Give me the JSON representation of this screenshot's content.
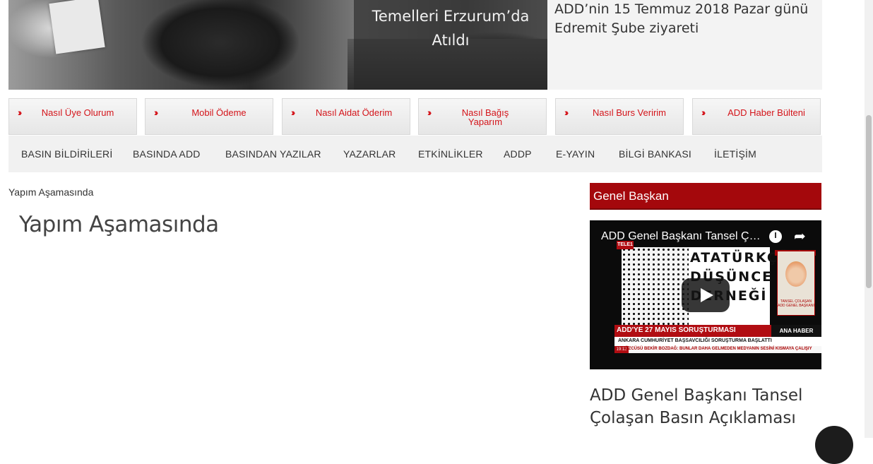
{
  "hero": {
    "caption": "Temelleri Erzurum’da Atıldı",
    "side_news": "ADD’nin 15 Temmuz 2018 Pazar günü Edremit Şube ziyareti"
  },
  "quick_links": [
    {
      "label": "Nasıl Üye Olurum"
    },
    {
      "label": "Mobil Ödeme"
    },
    {
      "label": "Nasıl Aidat Öderim"
    },
    {
      "label": "Nasıl Bağış Yaparım"
    },
    {
      "label": "Nasıl Burs Veririm"
    },
    {
      "label": "ADD Haber Bülteni"
    }
  ],
  "menu": [
    {
      "label": "BASIN BİLDİRİLERİ"
    },
    {
      "label": "BASINDA ADD"
    },
    {
      "label": "BASINDAN YAZILAR"
    },
    {
      "label": "YAZARLAR"
    },
    {
      "label": "ETKİNLİKLER"
    },
    {
      "label": "ADDP"
    },
    {
      "label": "E-YAYIN"
    },
    {
      "label": "BİLGİ BANKASI"
    },
    {
      "label": "İLETİŞİM"
    }
  ],
  "breadcrumb": "Yapım Aşamasında",
  "page_title": "Yapım Aşamasında",
  "widget": {
    "title": "Genel Başkan",
    "video": {
      "title": "ADD Genel Başkanı Tansel Çolaşan Basın Açıklaması",
      "channel_logo": "TELE1",
      "big_text": "ATATÜRKÇÜ DÜŞÜNCE DERNEĞİ",
      "banner": "ADD'YE 27 MAYIS SORUŞTURMASI",
      "banner_right": "ANA HABER",
      "subline": "ANKARA CUMHURİYET BAŞSAVCILIĞI SORUŞTURMA BAŞLATTI",
      "ticker_time": "19:13",
      "ticker": "ÖZCÜSÜ BEKİR BOZDAĞ: BUNLAR DAHA GELMEDEN MEDYANIN SESİNİ KISMAYA ÇALIŞIY",
      "portrait_header": "TELEFON BAĞLANTISI",
      "portrait_name": "TANSEL ÇOLAŞAN ADD GENEL BAŞKANI"
    },
    "article_title": "ADD Genel Başkanı Tansel Çolaşan Basın Açıklaması"
  },
  "colors": {
    "accent": "#d4141a",
    "widget_head": "#a4080c"
  }
}
